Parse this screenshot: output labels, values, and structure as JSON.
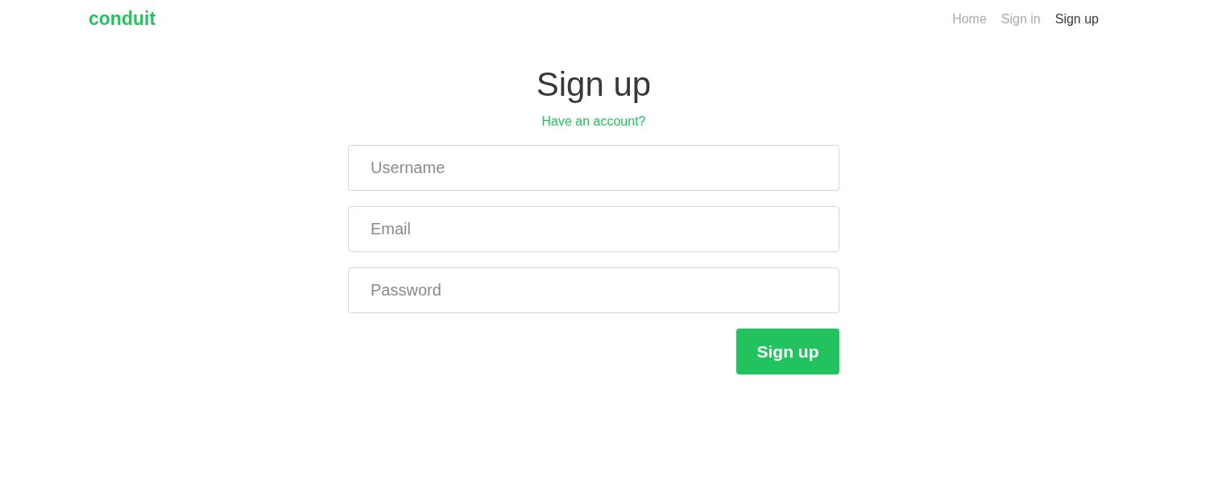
{
  "navbar": {
    "brand": "conduit",
    "links": [
      {
        "label": "Home",
        "selected": false
      },
      {
        "label": "Sign in",
        "selected": false
      },
      {
        "label": "Sign up",
        "selected": true
      }
    ]
  },
  "form": {
    "title": "Sign up",
    "link": "Have an account?",
    "fields": [
      {
        "placeholder": "Username"
      },
      {
        "placeholder": "Email"
      },
      {
        "placeholder": "Password"
      }
    ],
    "submit": "Sign up"
  }
}
